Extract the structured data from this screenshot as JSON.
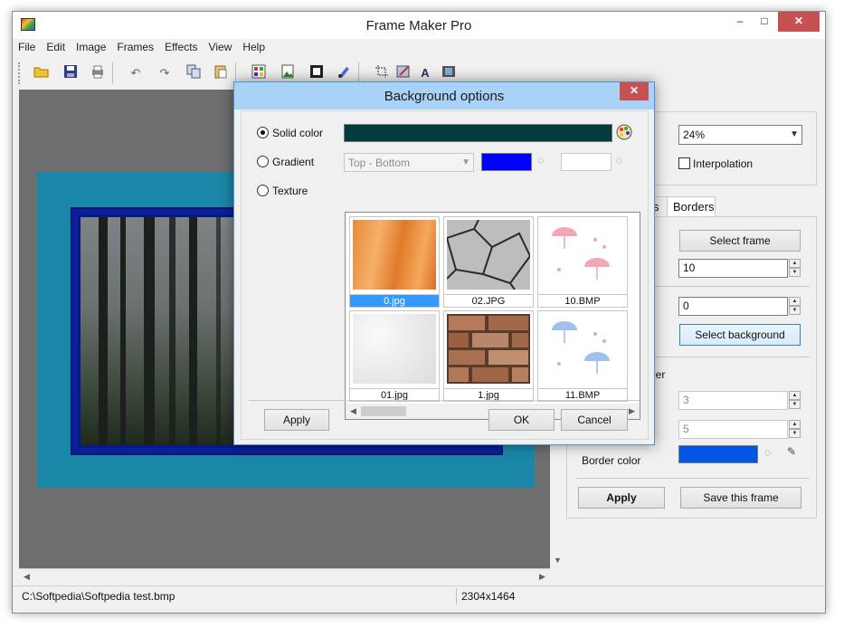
{
  "window": {
    "title": "Frame Maker Pro"
  },
  "window_controls": {
    "minimize": "–",
    "maximize": "□",
    "close": "✕"
  },
  "menu": [
    "File",
    "Edit",
    "Image",
    "Frames",
    "Effects",
    "View",
    "Help"
  ],
  "toolbar_icons": [
    "open-folder-icon",
    "save-icon",
    "print-icon",
    "undo-icon",
    "redo-icon",
    "copy-icon",
    "paste-icon",
    "image-color-icon",
    "image-green-icon",
    "frame-icon",
    "brush-icon",
    "crop-icon",
    "image-edit-icon",
    "text-icon",
    "film-icon"
  ],
  "right_panel": {
    "zoom": "24%",
    "interpolation_label": "Interpolation",
    "tabs": [
      "s",
      "Borders"
    ],
    "select_frame": "Select frame",
    "frame_width_value": "10",
    "background_offset_value": "0",
    "select_background": "Select background",
    "section_label": "der",
    "border_value_1": "3",
    "border_value_2": "5",
    "border_color_label": "Border color",
    "border_color": "#0055e5",
    "apply": "Apply",
    "save_frame": "Save this frame"
  },
  "status": {
    "path": "C:\\Softpedia\\Softpedia test.bmp",
    "size": "2304x1464"
  },
  "dialog": {
    "title": "Background options",
    "solid_label": "Solid color",
    "solid_color": "#003c3c",
    "gradient_label": "Gradient",
    "gradient_direction": "Top - Bottom",
    "gradient_color1": "#0000ff",
    "gradient_color2": "#ffffff",
    "texture_label": "Texture",
    "textures": [
      {
        "name": "0.jpg",
        "selected": true,
        "kind": "wood"
      },
      {
        "name": "02.JPG",
        "selected": false,
        "kind": "stone"
      },
      {
        "name": "10.BMP",
        "selected": false,
        "kind": "umbrella-pink"
      },
      {
        "name": "01.jpg",
        "selected": false,
        "kind": "plaster"
      },
      {
        "name": "1.jpg",
        "selected": false,
        "kind": "brick"
      },
      {
        "name": "11.BMP",
        "selected": false,
        "kind": "umbrella-blue"
      }
    ],
    "apply": "Apply",
    "ok": "OK",
    "cancel": "Cancel"
  }
}
